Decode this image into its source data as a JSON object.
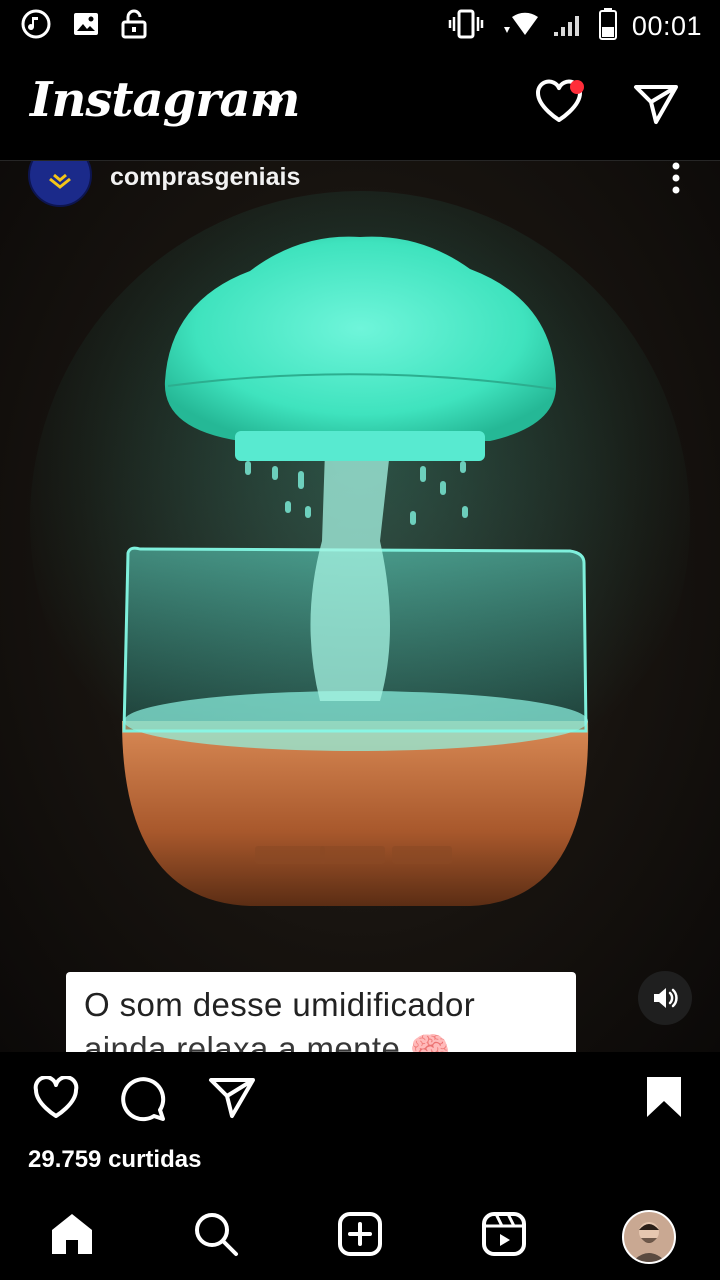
{
  "status_bar": {
    "time": "00:01",
    "icons": [
      "music-notification-icon",
      "image-notification-icon",
      "unlock-icon",
      "vibrate-icon",
      "wifi-icon",
      "signal-icon",
      "battery-icon"
    ]
  },
  "header": {
    "app_title": "Instagram",
    "icons": [
      "chevron-down-icon",
      "heart-icon",
      "direct-message-icon"
    ],
    "has_notification": true
  },
  "post": {
    "username": "comprasgeniais",
    "caption_line1": "O som desse umidificador",
    "caption_line2": "ainda relaxa a mente 🧠",
    "icons": [
      "more-options-icon",
      "sound-on-icon"
    ]
  },
  "actions": {
    "likes": "29.759 curtidas",
    "icons": [
      "like-icon",
      "comment-icon",
      "share-icon",
      "save-icon"
    ]
  },
  "bottom_nav": {
    "icons": [
      "home-icon",
      "search-icon",
      "create-icon",
      "reels-icon",
      "profile-avatar"
    ]
  },
  "colors": {
    "background": "#000000",
    "notification_dot": "#ff2d3a",
    "lamp_glow": "#3fe6c0",
    "base_wood": "#b8693a"
  }
}
